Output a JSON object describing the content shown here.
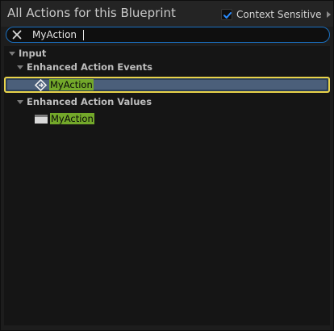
{
  "header": {
    "title": "All Actions for this Blueprint",
    "context_sensitive_label": "Context Sensitive",
    "context_sensitive_checked": true
  },
  "search": {
    "value": "MyAction",
    "placeholder": ""
  },
  "tree": {
    "root_category": "Input",
    "groups": [
      {
        "label": "Enhanced Action Events",
        "items": [
          {
            "label": "MyAction",
            "selected": true,
            "icon": "event-diamond-icon"
          }
        ]
      },
      {
        "label": "Enhanced Action Values",
        "items": [
          {
            "label": "MyAction",
            "selected": false,
            "icon": "variable-node-icon"
          }
        ]
      }
    ]
  },
  "colors": {
    "selection_border": "#e8d34a",
    "selection_fill": "#4b5f7a",
    "match_highlight": "#73a82a",
    "search_border": "#1a6fbf",
    "checkbox_accent": "#2a8cff"
  }
}
